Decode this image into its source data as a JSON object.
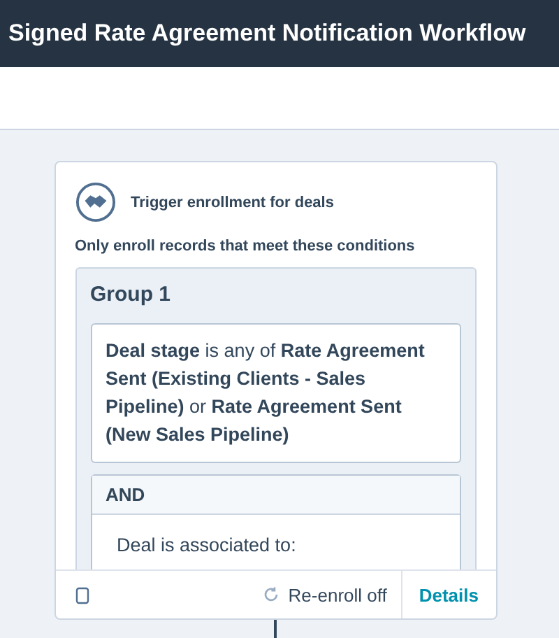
{
  "header": {
    "title": "Signed Rate Agreement Notification Workflow"
  },
  "trigger": {
    "title": "Trigger enrollment for deals",
    "subtitle": "Only enroll records that meet these conditions",
    "group": {
      "title": "Group 1",
      "condition": "**Deal stage** is any of **Rate Agreement Sent (Existing Clients - Sales Pipeline)** or **Rate Agreement Sent (New Sales Pipeline)**",
      "and_label": "AND",
      "and_condition": "Deal is associated to:"
    }
  },
  "footer": {
    "reenroll": "Re-enroll off",
    "details": "Details"
  }
}
